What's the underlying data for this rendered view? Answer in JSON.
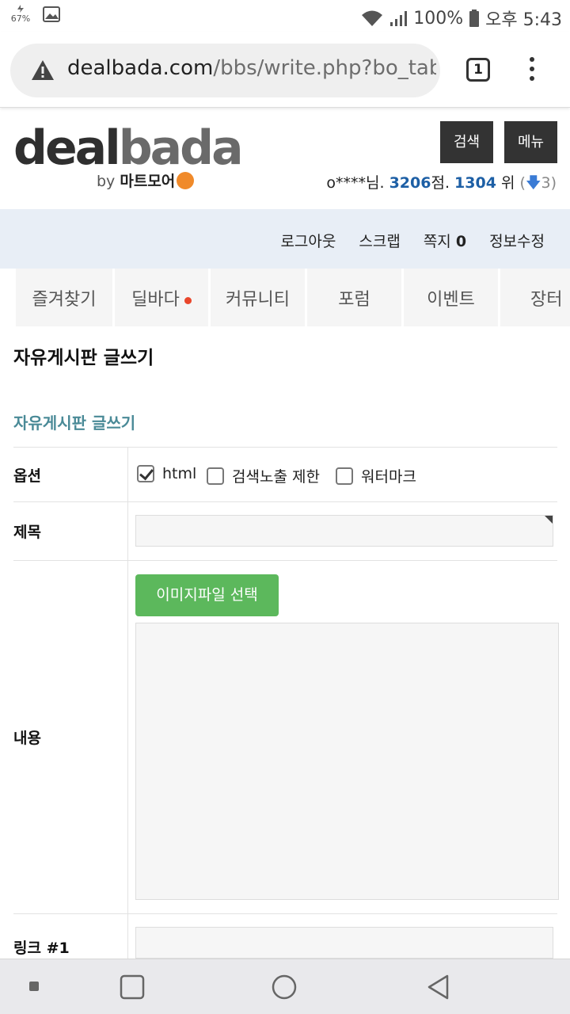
{
  "status_bar": {
    "battery_small": "67%",
    "battery_pct": "100%",
    "time": "오후 5:43",
    "icons": [
      "image-icon",
      "wifi-icon",
      "signal-icon",
      "battery-icon"
    ]
  },
  "browser": {
    "url_domain": "dealbada.com",
    "url_path": "/bbs/write.php?bo_table",
    "tab_count": "1"
  },
  "site": {
    "logo_deal": "deal",
    "logo_bada": "bada",
    "logo_by": "by",
    "logo_brand": "마트모어",
    "search_button": "검색",
    "menu_button": "메뉴",
    "user": {
      "name_prefix": "o****님.",
      "points": "3206",
      "points_suffix": "점.",
      "rank": "1304",
      "rank_suffix": "위",
      "paren_open": "(",
      "change_arrow": "🡇",
      "change": "3",
      "paren_close": ")"
    },
    "user_menu": {
      "logout": "로그아웃",
      "scrap": "스크랩",
      "memo_label": "쪽지",
      "memo_count": "0",
      "profile": "정보수정"
    },
    "nav_tabs": [
      "즐겨찾기",
      "딜바다",
      "커뮤니티",
      "포럼",
      "이벤트",
      "장터"
    ]
  },
  "page": {
    "title": "자유게시판 글쓰기",
    "subtitle": "자유게시판 글쓰기",
    "form": {
      "option_label": "옵션",
      "options": [
        {
          "label": "html",
          "checked": true
        },
        {
          "label": "검색노출 제한",
          "checked": false
        },
        {
          "label": "워터마크",
          "checked": false
        }
      ],
      "title_label": "제목",
      "title_value": "",
      "content_label": "내용",
      "image_button": "이미지파일 선택",
      "content_value": "",
      "link1_label": "링크 #1",
      "link1_value": ""
    }
  },
  "colors": {
    "accent_green": "#5cb85c",
    "link_blue": "#1d5fa5",
    "subtitle_teal": "#4a8a97",
    "notification_dot": "#e9462b"
  }
}
